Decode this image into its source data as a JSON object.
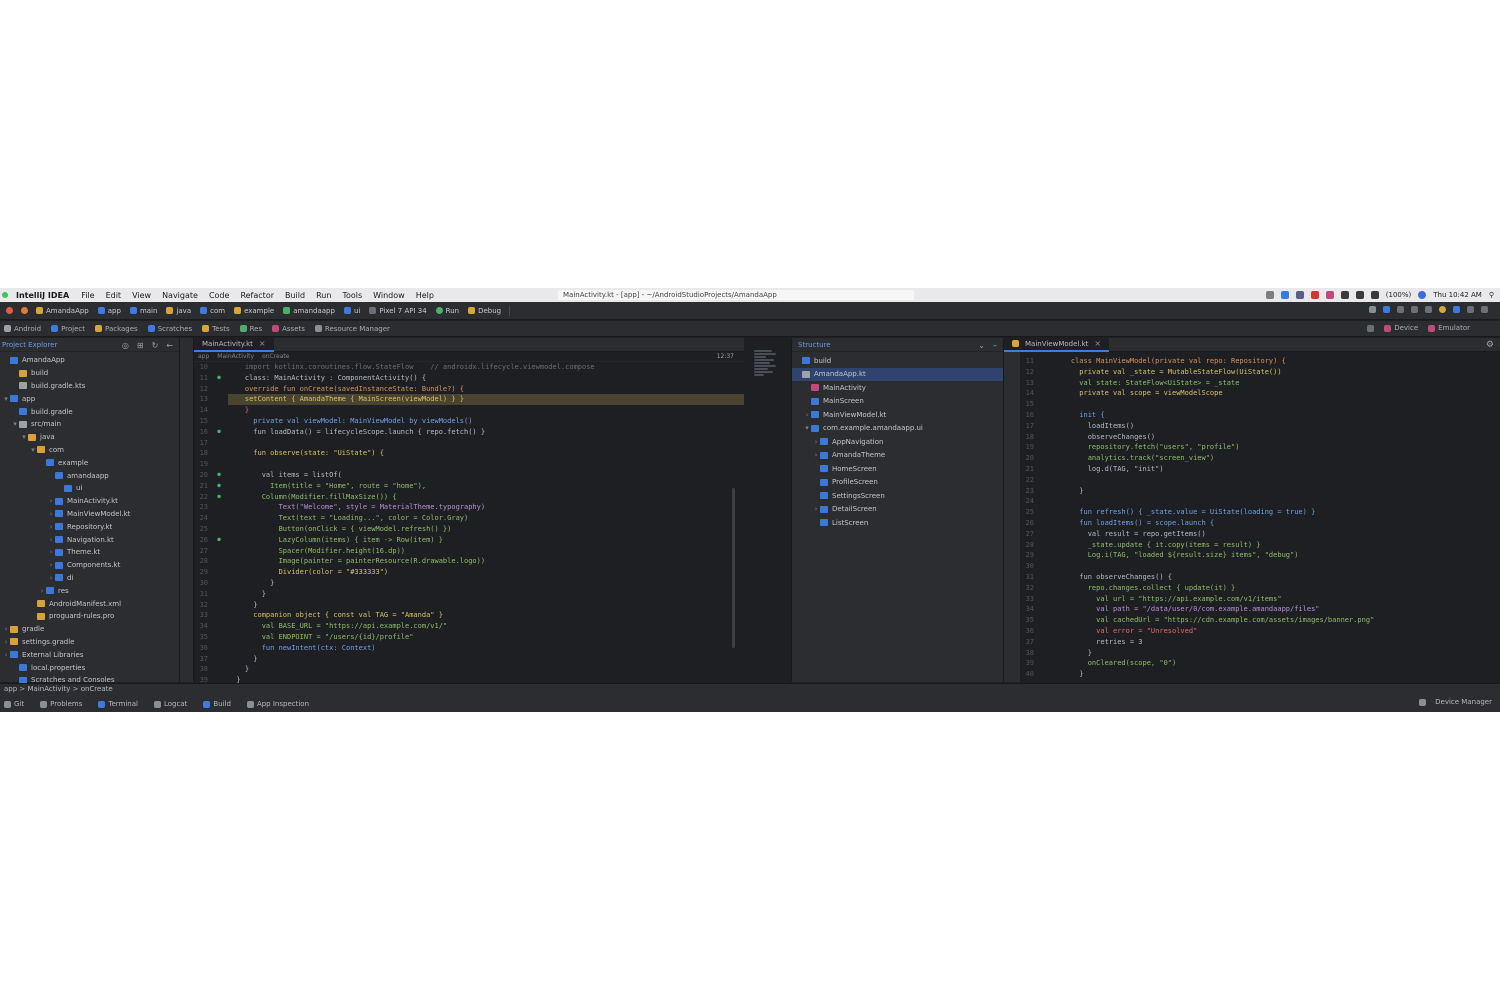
{
  "menubar": {
    "app_name": "IntelliJ IDEA",
    "menus": [
      "File",
      "Edit",
      "View",
      "Navigate",
      "Code",
      "Refactor",
      "Build",
      "Run",
      "Tools",
      "Window",
      "Help"
    ],
    "document_title": "MainActivity.kt - [app] - ~/AndroidStudioProjects/AmandaApp",
    "clock": "Thu 10:42 AM",
    "battery": "(100%)"
  },
  "toolbar": {
    "items": [
      "AmandaApp",
      "app",
      "main",
      "java",
      "com",
      "example",
      "amandaapp",
      "ui",
      "Pixel 7 API 34"
    ],
    "run_label": "Run",
    "debug_label": "Debug"
  },
  "tabbar": {
    "items": [
      "Android",
      "Project",
      "Packages",
      "Scratches",
      "Tests",
      "Res",
      "Assets",
      "Resource Manager"
    ],
    "right_items": [
      "Device",
      "Emulator"
    ]
  },
  "project": {
    "header": "Project Explorer",
    "rows": [
      {
        "indent": 0,
        "chev": "",
        "color": "#3c78d8",
        "label": "AmandaApp"
      },
      {
        "indent": 1,
        "chev": "",
        "color": "#d9a13b",
        "label": "build"
      },
      {
        "indent": 1,
        "chev": "",
        "color": "#9da1a8",
        "label": "build.gradle.kts"
      },
      {
        "indent": 0,
        "chev": "v",
        "color": "#3c78d8",
        "label": "app"
      },
      {
        "indent": 1,
        "chev": "",
        "color": "#3c78d8",
        "label": "build.gradle"
      },
      {
        "indent": 1,
        "chev": "v",
        "color": "#9da1a8",
        "label": "src/main"
      },
      {
        "indent": 2,
        "chev": "v",
        "color": "#d9a13b",
        "label": "java"
      },
      {
        "indent": 3,
        "chev": "v",
        "color": "#d9a13b",
        "label": "com"
      },
      {
        "indent": 4,
        "chev": "",
        "color": "#3c78d8",
        "label": "example"
      },
      {
        "indent": 5,
        "chev": "",
        "color": "#3c78d8",
        "label": "amandaapp"
      },
      {
        "indent": 6,
        "chev": "",
        "color": "#3c78d8",
        "label": "ui"
      },
      {
        "indent": 5,
        "chev": ">",
        "color": "#3c78d8",
        "label": "MainActivity.kt"
      },
      {
        "indent": 5,
        "chev": ">",
        "color": "#3c78d8",
        "label": "MainViewModel.kt"
      },
      {
        "indent": 5,
        "chev": ">",
        "color": "#3c78d8",
        "label": "Repository.kt"
      },
      {
        "indent": 5,
        "chev": ">",
        "color": "#3c78d8",
        "label": "Navigation.kt"
      },
      {
        "indent": 5,
        "chev": ">",
        "color": "#3c78d8",
        "label": "Theme.kt"
      },
      {
        "indent": 5,
        "chev": ">",
        "color": "#3c78d8",
        "label": "Components.kt"
      },
      {
        "indent": 5,
        "chev": ">",
        "color": "#3c78d8",
        "label": "di"
      },
      {
        "indent": 4,
        "chev": ">",
        "color": "#3c78d8",
        "label": "res"
      },
      {
        "indent": 3,
        "chev": "",
        "color": "#d9a13b",
        "label": "AndroidManifest.xml"
      },
      {
        "indent": 3,
        "chev": "",
        "color": "#d9a13b",
        "label": "proguard-rules.pro"
      },
      {
        "indent": 0,
        "chev": ">",
        "color": "#d9a13b",
        "label": "gradle"
      },
      {
        "indent": 0,
        "chev": ">",
        "color": "#d9a13b",
        "label": "settings.gradle"
      },
      {
        "indent": 0,
        "chev": ">",
        "color": "#3c78d8",
        "label": "External Libraries"
      },
      {
        "indent": 1,
        "chev": "",
        "color": "#3c78d8",
        "label": "local.properties"
      },
      {
        "indent": 1,
        "chev": "",
        "color": "#3c78d8",
        "label": "Scratches and Consoles"
      }
    ]
  },
  "editor1": {
    "tab": "MainActivity.kt",
    "crumbs": [
      "app",
      "MainActivity",
      "onCreate"
    ],
    "crumbs_right": "12:37",
    "lines": [
      {
        "n": "10",
        "g": "",
        "c": "gry",
        "t": "    import kotlinx.coroutines.flow.StateFlow    // androidx.lifecycle.viewmodel.compose"
      },
      {
        "n": "11",
        "g": "o",
        "c": "lbl",
        "t": "    class: MainActivity : ComponentActivity() {"
      },
      {
        "n": "12",
        "g": "",
        "c": "org",
        "t": "    override fun onCreate(savedInstanceState: Bundle?) {"
      },
      {
        "n": "13",
        "g": "",
        "c": "yel",
        "t": "    setContent { AmandaTheme { MainScreen(viewModel) } }",
        "hl": true
      },
      {
        "n": "14",
        "g": "",
        "c": "red",
        "t": "    }"
      },
      {
        "n": "15",
        "g": "",
        "c": "blu",
        "t": "      private val viewModel: MainViewModel by viewModels()"
      },
      {
        "n": "16",
        "g": "o",
        "c": "lbl",
        "t": "      fun loadData() = lifecycleScope.launch { repo.fetch() }"
      },
      {
        "n": "17",
        "g": "",
        "c": "gry",
        "t": ""
      },
      {
        "n": "18",
        "g": "",
        "c": "yel",
        "t": "      fun observe(state: \"UiState\") {"
      },
      {
        "n": "19",
        "g": "",
        "c": "gry",
        "t": ""
      },
      {
        "n": "20",
        "g": "o",
        "c": "lbl",
        "t": "        val items = listOf("
      },
      {
        "n": "21",
        "g": "o",
        "c": "grn",
        "t": "          Item(title = \"Home\", route = \"home\"),"
      },
      {
        "n": "22",
        "g": "o",
        "c": "grn",
        "t": "        Column(Modifier.fillMaxSize()) {"
      },
      {
        "n": "23",
        "g": "",
        "c": "pur",
        "t": "            Text(\"Welcome\", style = MaterialTheme.typography)"
      },
      {
        "n": "24",
        "g": "",
        "c": "grn",
        "t": "            Text(text = \"Loading...\", color = Color.Gray)"
      },
      {
        "n": "25",
        "g": "",
        "c": "grn",
        "t": "            Button(onClick = { viewModel.refresh() })"
      },
      {
        "n": "26",
        "g": "o",
        "c": "grn",
        "t": "            LazyColumn(items) { item -> Row(item) }"
      },
      {
        "n": "27",
        "g": "",
        "c": "grn",
        "t": "            Spacer(Modifier.height(16.dp))"
      },
      {
        "n": "28",
        "g": "",
        "c": "grn",
        "t": "            Image(painter = painterResource(R.drawable.logo))"
      },
      {
        "n": "29",
        "g": "",
        "c": "yel",
        "t": "            Divider(color = \"#333333\")"
      },
      {
        "n": "30",
        "g": "",
        "c": "lbl",
        "t": "          }"
      },
      {
        "n": "31",
        "g": "",
        "c": "lbl",
        "t": "        }"
      },
      {
        "n": "32",
        "g": "",
        "c": "lbl",
        "t": "      }"
      },
      {
        "n": "33",
        "g": "",
        "c": "yel",
        "t": "      companion object { const val TAG = \"Amanda\" }"
      },
      {
        "n": "34",
        "g": "",
        "c": "grn",
        "t": "        val BASE_URL = \"https://api.example.com/v1/\""
      },
      {
        "n": "35",
        "g": "",
        "c": "grn",
        "t": "        val ENDPOINT = \"/users/{id}/profile\""
      },
      {
        "n": "36",
        "g": "",
        "c": "blu",
        "t": "        fun newIntent(ctx: Context)"
      },
      {
        "n": "37",
        "g": "",
        "c": "lbl",
        "t": "      }"
      },
      {
        "n": "38",
        "g": "",
        "c": "lbl",
        "t": "    }"
      },
      {
        "n": "39",
        "g": "",
        "c": "lbl",
        "t": "  }"
      }
    ]
  },
  "structure": {
    "header": "Structure",
    "rows": [
      {
        "indent": 0,
        "chev": "",
        "color": "#3c78d8",
        "label": "build"
      },
      {
        "indent": 0,
        "chev": "",
        "color": "#9da1a8",
        "label": "AmandaApp.kt",
        "sel": true
      },
      {
        "indent": 1,
        "chev": "",
        "color": "#c0487a",
        "label": "MainActivity"
      },
      {
        "indent": 1,
        "chev": "",
        "color": "#3c78d8",
        "label": "MainScreen"
      },
      {
        "indent": 1,
        "chev": ">",
        "color": "#3c78d8",
        "label": "MainViewModel.kt"
      },
      {
        "indent": 1,
        "chev": "v",
        "color": "#3c78d8",
        "label": "com.example.amandaapp.ui"
      },
      {
        "indent": 2,
        "chev": ">",
        "color": "#3c78d8",
        "label": "AppNavigation"
      },
      {
        "indent": 2,
        "chev": ">",
        "color": "#3c78d8",
        "label": "AmandaTheme"
      },
      {
        "indent": 2,
        "chev": "",
        "color": "#3c78d8",
        "label": "HomeScreen"
      },
      {
        "indent": 2,
        "chev": "",
        "color": "#3c78d8",
        "label": "ProfileScreen"
      },
      {
        "indent": 2,
        "chev": "",
        "color": "#3c78d8",
        "label": "SettingsScreen"
      },
      {
        "indent": 2,
        "chev": ">",
        "color": "#3c78d8",
        "label": "DetailScreen"
      },
      {
        "indent": 2,
        "chev": "",
        "color": "#3c78d8",
        "label": "ListScreen"
      }
    ]
  },
  "editor2": {
    "tab": "MainViewModel.kt",
    "lines": [
      {
        "n": "11",
        "c": "org",
        "t": "    class MainViewModel(private val repo: Repository) {"
      },
      {
        "n": "12",
        "c": "yel",
        "t": "      private val _state = MutableStateFlow(UiState())"
      },
      {
        "n": "13",
        "c": "grn",
        "t": "      val state: StateFlow<UiState> = _state"
      },
      {
        "n": "14",
        "c": "yel",
        "t": "      private val scope = viewModelScope"
      },
      {
        "n": "15",
        "c": "gry",
        "t": ""
      },
      {
        "n": "16",
        "c": "blu",
        "t": "      init {"
      },
      {
        "n": "17",
        "c": "lbl",
        "t": "        loadItems()"
      },
      {
        "n": "18",
        "c": "lbl",
        "t": "        observeChanges()"
      },
      {
        "n": "19",
        "c": "grn",
        "t": "        repository.fetch(\"users\", \"profile\")"
      },
      {
        "n": "20",
        "c": "grn",
        "t": "        analytics.track(\"screen_view\")"
      },
      {
        "n": "21",
        "c": "lbl",
        "t": "        log.d(TAG, \"init\")"
      },
      {
        "n": "22",
        "c": "gry",
        "t": ""
      },
      {
        "n": "23",
        "c": "lbl",
        "t": "      }"
      },
      {
        "n": "24",
        "c": "gry",
        "t": ""
      },
      {
        "n": "25",
        "c": "blu",
        "t": "      fun refresh() { _state.value = UiState(loading = true) }"
      },
      {
        "n": "26",
        "c": "blu",
        "t": "      fun loadItems() = scope.launch {"
      },
      {
        "n": "27",
        "c": "lbl",
        "t": "        val result = repo.getItems()"
      },
      {
        "n": "28",
        "c": "grn",
        "t": "        _state.update { it.copy(items = result) }"
      },
      {
        "n": "29",
        "c": "grn",
        "t": "        Log.i(TAG, \"loaded ${result.size} items\", \"debug\")"
      },
      {
        "n": "30",
        "c": "gry",
        "t": ""
      },
      {
        "n": "31",
        "c": "lbl",
        "t": "      fun observeChanges() {"
      },
      {
        "n": "32",
        "c": "grn",
        "t": "        repo.changes.collect { update(it) }"
      },
      {
        "n": "33",
        "c": "grn",
        "t": "          val url = \"https://api.example.com/v1/items\""
      },
      {
        "n": "34",
        "c": "pur",
        "t": "          val path = \"/data/user/0/com.example.amandaapp/files\""
      },
      {
        "n": "35",
        "c": "grn",
        "t": "          val cachedUrl = \"https://cdn.example.com/assets/images/banner.png\""
      },
      {
        "n": "36",
        "c": "red",
        "t": "          val error = \"Unresolved\""
      },
      {
        "n": "37",
        "c": "lbl",
        "t": "          retries = 3"
      },
      {
        "n": "38",
        "c": "lbl",
        "t": "        }"
      },
      {
        "n": "39",
        "c": "grn",
        "t": "        onCleared(scope, \"0\")"
      },
      {
        "n": "40",
        "c": "lbl",
        "t": "      }"
      }
    ]
  },
  "status": {
    "row1": "app > MainActivity > onCreate",
    "items": [
      "Git",
      "Problems",
      "Terminal",
      "Logcat",
      "Build",
      "App Inspection"
    ],
    "right": "Device Manager"
  }
}
